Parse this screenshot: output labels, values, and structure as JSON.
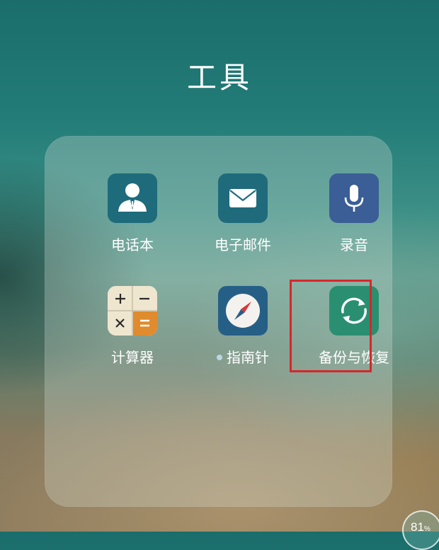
{
  "folder": {
    "title": "工具"
  },
  "apps": [
    {
      "label": "电话本",
      "icon": "contact-person-icon",
      "color": "#1e6b7b"
    },
    {
      "label": "电子邮件",
      "icon": "envelope-icon",
      "color": "#1f6b7c"
    },
    {
      "label": "录音",
      "icon": "microphone-icon",
      "color": "#3a5e95"
    },
    {
      "label": "计算器",
      "icon": "calculator-icon",
      "color": "#efe6d0"
    },
    {
      "label": "指南针",
      "icon": "compass-icon",
      "color": "#265f86",
      "has_update_dot": true
    },
    {
      "label": "备份与恢复",
      "icon": "sync-arrows-icon",
      "color": "#2a8f70"
    }
  ],
  "status": {
    "battery_value": "81",
    "battery_unit": "%"
  },
  "highlight_color": "#d8262b"
}
